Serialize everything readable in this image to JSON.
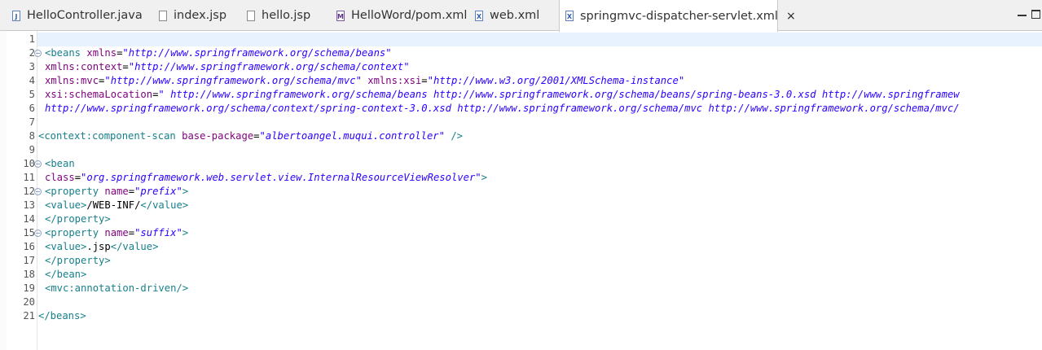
{
  "tabs": [
    {
      "label": "HelloController.java",
      "icon": "java-file-icon",
      "glyph": "J"
    },
    {
      "label": "index.jsp",
      "icon": "jsp-file-icon",
      "glyph": ""
    },
    {
      "label": "hello.jsp",
      "icon": "jsp-file-icon",
      "glyph": ""
    },
    {
      "label": "HelloWord/pom.xml",
      "icon": "maven-pom-icon",
      "glyph": "M"
    },
    {
      "label": "web.xml",
      "icon": "xml-file-icon",
      "glyph": "X"
    },
    {
      "label": "springmvc-dispatcher-servlet.xml",
      "icon": "xml-file-icon",
      "glyph": "X",
      "active": true,
      "close": "×"
    }
  ],
  "editor": {
    "current_line": 1,
    "lines": [
      {
        "n": "1",
        "fold": false,
        "indent": 0,
        "tokens": []
      },
      {
        "n": "2",
        "fold": true,
        "indent": 1,
        "tokens": [
          {
            "t": "tag",
            "v": "<beans "
          },
          {
            "t": "attr",
            "v": "xmlns"
          },
          {
            "t": "txt",
            "v": "="
          },
          {
            "t": "val",
            "v": "\"http://www.springframework.org/schema/beans\""
          }
        ]
      },
      {
        "n": "3",
        "fold": false,
        "indent": 1,
        "tokens": [
          {
            "t": "attr",
            "v": "xmlns:context"
          },
          {
            "t": "txt",
            "v": "="
          },
          {
            "t": "val",
            "v": "\"http://www.springframework.org/schema/context\""
          }
        ]
      },
      {
        "n": "4",
        "fold": false,
        "indent": 1,
        "tokens": [
          {
            "t": "attr",
            "v": "xmlns:mvc"
          },
          {
            "t": "txt",
            "v": "="
          },
          {
            "t": "val",
            "v": "\"http://www.springframework.org/schema/mvc\""
          },
          {
            "t": "txt",
            "v": " "
          },
          {
            "t": "attr",
            "v": "xmlns:xsi"
          },
          {
            "t": "txt",
            "v": "="
          },
          {
            "t": "val",
            "v": "\"http://www.w3.org/2001/XMLSchema-instance\""
          }
        ]
      },
      {
        "n": "5",
        "fold": false,
        "indent": 1,
        "tokens": [
          {
            "t": "attr",
            "v": "xsi:schemaLocation"
          },
          {
            "t": "txt",
            "v": "="
          },
          {
            "t": "val",
            "v": "\" http://www.springframework.org/schema/beans http://www.springframework.org/schema/beans/spring-beans-3.0.xsd http://www.springframew"
          }
        ]
      },
      {
        "n": "6",
        "fold": false,
        "indent": 1,
        "tokens": [
          {
            "t": "val",
            "v": "http://www.springframework.org/schema/context/spring-context-3.0.xsd http://www.springframework.org/schema/mvc http://www.springframework.org/schema/mvc/"
          }
        ]
      },
      {
        "n": "7",
        "fold": false,
        "indent": 0,
        "tokens": []
      },
      {
        "n": "8",
        "fold": false,
        "indent": 0,
        "tokens": [
          {
            "t": "tag",
            "v": "<context:component-scan "
          },
          {
            "t": "attr",
            "v": "base-package"
          },
          {
            "t": "txt",
            "v": "="
          },
          {
            "t": "val",
            "v": "\"albertoangel.muqui.controller\""
          },
          {
            "t": "tag",
            "v": " />"
          }
        ]
      },
      {
        "n": "9",
        "fold": false,
        "indent": 0,
        "tokens": []
      },
      {
        "n": "10",
        "fold": true,
        "indent": 1,
        "tokens": [
          {
            "t": "tag",
            "v": "<bean"
          }
        ]
      },
      {
        "n": "11",
        "fold": false,
        "indent": 1,
        "tokens": [
          {
            "t": "attr",
            "v": "class"
          },
          {
            "t": "txt",
            "v": "="
          },
          {
            "t": "val",
            "v": "\"org.springframework.web.servlet.view.InternalResourceViewResolver\""
          },
          {
            "t": "tag",
            "v": ">"
          }
        ]
      },
      {
        "n": "12",
        "fold": true,
        "indent": 1,
        "tokens": [
          {
            "t": "tag",
            "v": "<property "
          },
          {
            "t": "attr",
            "v": "name"
          },
          {
            "t": "txt",
            "v": "="
          },
          {
            "t": "val",
            "v": "\"prefix\""
          },
          {
            "t": "tag",
            "v": ">"
          }
        ]
      },
      {
        "n": "13",
        "fold": false,
        "indent": 1,
        "tokens": [
          {
            "t": "tag",
            "v": "<value>"
          },
          {
            "t": "txt",
            "v": "/WEB-INF/"
          },
          {
            "t": "tag",
            "v": "</value>"
          }
        ]
      },
      {
        "n": "14",
        "fold": false,
        "indent": 1,
        "tokens": [
          {
            "t": "tag",
            "v": "</property>"
          }
        ]
      },
      {
        "n": "15",
        "fold": true,
        "indent": 1,
        "tokens": [
          {
            "t": "tag",
            "v": "<property "
          },
          {
            "t": "attr",
            "v": "name"
          },
          {
            "t": "txt",
            "v": "="
          },
          {
            "t": "val",
            "v": "\"suffix\""
          },
          {
            "t": "tag",
            "v": ">"
          }
        ]
      },
      {
        "n": "16",
        "fold": false,
        "indent": 1,
        "tokens": [
          {
            "t": "tag",
            "v": "<value>"
          },
          {
            "t": "txt",
            "v": ".jsp"
          },
          {
            "t": "tag",
            "v": "</value>"
          }
        ]
      },
      {
        "n": "17",
        "fold": false,
        "indent": 1,
        "tokens": [
          {
            "t": "tag",
            "v": "</property>"
          }
        ]
      },
      {
        "n": "18",
        "fold": false,
        "indent": 1,
        "tokens": [
          {
            "t": "tag",
            "v": "</bean>"
          }
        ]
      },
      {
        "n": "19",
        "fold": false,
        "indent": 1,
        "tokens": [
          {
            "t": "tag",
            "v": "<mvc:annotation-driven/>"
          }
        ]
      },
      {
        "n": "20",
        "fold": false,
        "indent": 0,
        "tokens": []
      },
      {
        "n": "21",
        "fold": false,
        "indent": 0,
        "tokens": [
          {
            "t": "tag",
            "v": "</beans>"
          }
        ]
      }
    ]
  },
  "window_controls": {
    "minimize": "minimize-icon",
    "maximize": "maximize-icon"
  }
}
